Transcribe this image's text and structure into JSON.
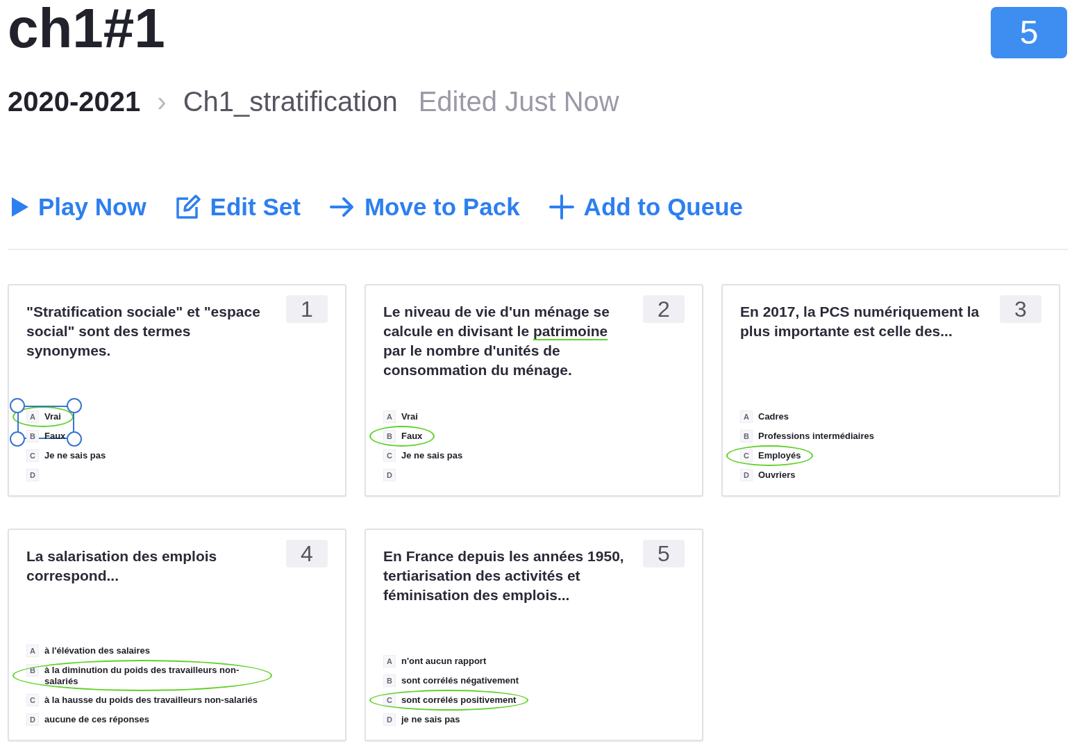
{
  "title": "ch1#1",
  "count_badge": "5",
  "breadcrumb": {
    "parent": "2020-2021",
    "separator": "›",
    "current": "Ch1_stratification",
    "status": "Edited Just Now"
  },
  "actions": [
    {
      "kind": "play",
      "label": "Play Now"
    },
    {
      "kind": "edit",
      "label": "Edit Set"
    },
    {
      "kind": "move",
      "label": "Move to Pack"
    },
    {
      "kind": "add",
      "label": "Add to Queue"
    }
  ],
  "cards": [
    {
      "number": "1",
      "question": [
        {
          "text": "\"Stratification sociale\" et \"espace social\" sont des termes synonymes.",
          "underlined": false
        }
      ],
      "options": [
        {
          "letter": "A",
          "text": "Vrai",
          "circled": true,
          "selection_box": true
        },
        {
          "letter": "B",
          "text": "Faux",
          "circled": false,
          "selection_box": false
        },
        {
          "letter": "C",
          "text": "Je ne sais pas",
          "circled": false,
          "selection_box": false
        },
        {
          "letter": "D",
          "circled": false,
          "selection_box": false
        }
      ]
    },
    {
      "number": "2",
      "question": [
        {
          "text": "Le niveau de vie d'un ménage se calcule en divisant le ",
          "underlined": false
        },
        {
          "text": "patrimoine",
          "underlined": true
        },
        {
          "text": " par le nombre d'unités de consommation du ménage.",
          "underlined": false
        }
      ],
      "options": [
        {
          "letter": "A",
          "text": "Vrai",
          "circled": false,
          "selection_box": false
        },
        {
          "letter": "B",
          "text": "Faux",
          "circled": true,
          "selection_box": false
        },
        {
          "letter": "C",
          "text": "Je ne sais pas",
          "circled": false,
          "selection_box": false
        },
        {
          "letter": "D",
          "circled": false,
          "selection_box": false
        }
      ]
    },
    {
      "number": "3",
      "question": [
        {
          "text": "En 2017, la PCS numériquement la plus importante est celle des...",
          "underlined": false
        }
      ],
      "options": [
        {
          "letter": "A",
          "text": "Cadres",
          "circled": false,
          "selection_box": false
        },
        {
          "letter": "B",
          "text": "Professions intermédiaires",
          "circled": false,
          "selection_box": false
        },
        {
          "letter": "C",
          "text": "Employés",
          "circled": true,
          "selection_box": false
        },
        {
          "letter": "D",
          "text": "Ouvriers",
          "circled": false,
          "selection_box": false
        }
      ]
    },
    {
      "number": "4",
      "question": [
        {
          "text": "La salarisation des emplois correspond...",
          "underlined": false
        }
      ],
      "options": [
        {
          "letter": "A",
          "text": "à l'élévation des salaires",
          "circled": false,
          "selection_box": false
        },
        {
          "letter": "B",
          "text": "à la diminution du poids des travailleurs non-salariés",
          "circled": true,
          "selection_box": false
        },
        {
          "letter": "C",
          "text": "à la hausse du poids des travailleurs non-salariés",
          "circled": false,
          "selection_box": false
        },
        {
          "letter": "D",
          "text": "aucune de ces réponses",
          "circled": false,
          "selection_box": false
        }
      ]
    },
    {
      "number": "5",
      "question": [
        {
          "text": "En France depuis les années 1950, tertiarisation des activités et féminisation des emplois...",
          "underlined": false
        }
      ],
      "options": [
        {
          "letter": "A",
          "text": "n'ont aucun rapport",
          "circled": false,
          "selection_box": false
        },
        {
          "letter": "B",
          "text": "sont corrélés négativement",
          "circled": false,
          "selection_box": false
        },
        {
          "letter": "C",
          "text": "sont corrélés positivement",
          "circled": true,
          "selection_box": false
        },
        {
          "letter": "D",
          "text": "je ne sais pas",
          "circled": false,
          "selection_box": false
        }
      ]
    }
  ]
}
